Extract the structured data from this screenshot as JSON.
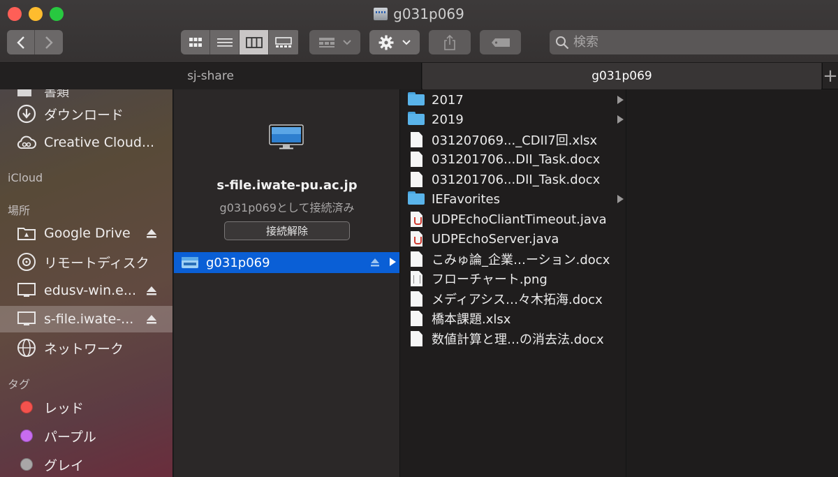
{
  "window": {
    "title": "g031p069"
  },
  "toolbar": {
    "search_placeholder": "検索",
    "view_modes": [
      "icon-view",
      "list-view",
      "column-view",
      "gallery-view"
    ],
    "active_view": "column-view"
  },
  "tabs": [
    {
      "label": "sj-share",
      "active": false
    },
    {
      "label": "g031p069",
      "active": true
    }
  ],
  "sidebar": {
    "partial_top_label": "書類",
    "items_top": [
      {
        "label": "ダウンロード",
        "icon": "download-icon"
      },
      {
        "label": "Creative Cloud...",
        "icon": "creative-cloud-icon"
      }
    ],
    "icloud_header": "iCloud",
    "locations_header": "場所",
    "locations": [
      {
        "label": "Google Drive",
        "icon": "drive-icon",
        "eject": true
      },
      {
        "label": "リモートディスク",
        "icon": "disc-icon",
        "eject": false
      },
      {
        "label": "edusv-win.e...",
        "icon": "monitor-icon",
        "eject": true
      },
      {
        "label": "s-file.iwate-...",
        "icon": "monitor-icon",
        "eject": true,
        "selected": true
      },
      {
        "label": "ネットワーク",
        "icon": "network-icon",
        "eject": false
      }
    ],
    "tags_header": "タグ",
    "tags": [
      {
        "label": "レッド",
        "color": "#f4524d"
      },
      {
        "label": "パープル",
        "color": "#c86cf0"
      },
      {
        "label": "グレイ",
        "color": "#a9a7a7"
      }
    ]
  },
  "server": {
    "name": "s-file.iwate-pu.ac.jp",
    "status": "g031p069として接続済み",
    "disconnect_label": "接続解除",
    "share_label": "g031p069"
  },
  "files": [
    {
      "name": "2017",
      "type": "folder",
      "has_children": true
    },
    {
      "name": "2019",
      "type": "folder",
      "has_children": true
    },
    {
      "name": "031207069..._CDII7回.xlsx",
      "type": "doc"
    },
    {
      "name": "031201706...DII_Task.docx",
      "type": "doc"
    },
    {
      "name": "031201706...DII_Task.docx",
      "type": "doc"
    },
    {
      "name": "IEFavorites",
      "type": "folder",
      "has_children": true
    },
    {
      "name": "UDPEchoCliantTimeout.java",
      "type": "java"
    },
    {
      "name": "UDPEchoServer.java",
      "type": "java"
    },
    {
      "name": "こみゅ論_企業…ーション.docx",
      "type": "doc"
    },
    {
      "name": "フローチャート.png",
      "type": "png"
    },
    {
      "name": "メディアシス…々木拓海.docx",
      "type": "doc"
    },
    {
      "name": "橋本課題.xlsx",
      "type": "doc"
    },
    {
      "name": "数値計算と理…の消去法.docx",
      "type": "doc"
    }
  ]
}
